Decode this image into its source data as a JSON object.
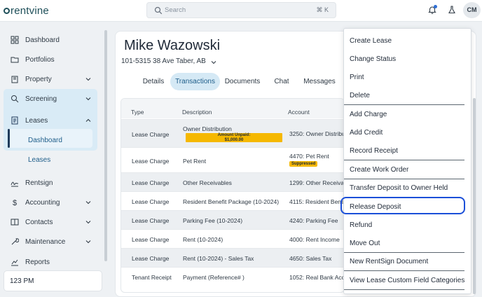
{
  "app": {
    "logo_text": "rentvine"
  },
  "search": {
    "placeholder": "Search",
    "shortcut": "⌘ K"
  },
  "user": {
    "initials": "CM"
  },
  "icons": {
    "logo": "rentvine-logo",
    "search": "search-icon",
    "bell": "bell-icon",
    "flask": "flask-icon",
    "dashboard": "grid-icon",
    "portfolios": "folder-icon",
    "property": "building-icon",
    "screening": "search-icon",
    "leases": "document-icon",
    "rentsign": "signature-icon",
    "accounting": "dollar-icon",
    "contacts": "address-book-icon",
    "maintenance": "wrench-icon",
    "reports": "chart-icon"
  },
  "sidebar": {
    "items": [
      {
        "label": "Dashboard"
      },
      {
        "label": "Portfolios"
      },
      {
        "label": "Property"
      },
      {
        "label": "Screening"
      },
      {
        "label": "Leases"
      },
      {
        "label": "Rentsign"
      },
      {
        "label": "Accounting"
      },
      {
        "label": "Contacts"
      },
      {
        "label": "Maintenance"
      },
      {
        "label": "Reports"
      }
    ],
    "lease_sub": [
      {
        "label": "Dashboard"
      },
      {
        "label": "Leases"
      }
    ],
    "time_text": "123 PM"
  },
  "lease": {
    "tenant_name": "Mike Wazowski",
    "address": "101-5315 38 Ave Taber, AB"
  },
  "tabs": [
    {
      "label": "Details"
    },
    {
      "label": "Transactions"
    },
    {
      "label": "Documents"
    },
    {
      "label": "Chat"
    },
    {
      "label": "Messages"
    }
  ],
  "table": {
    "headers": [
      "Type",
      "Description",
      "Account"
    ],
    "rows": [
      {
        "type": "Lease Charge",
        "description": "Owner Distribution",
        "account": "3250: Owner Distribu",
        "badge": "Amount Unpaid:\n$1,000.00"
      },
      {
        "type": "Lease Charge",
        "description": "Pet Rent",
        "account": "4470: Pet Rent",
        "badge": "Suppressed"
      },
      {
        "type": "Lease Charge",
        "description": "Other Receivables",
        "account": "1299: Other Receivabl"
      },
      {
        "type": "Lease Charge",
        "description": "Resident Benefit Package (10-2024)",
        "account": "4115: Resident Benefi"
      },
      {
        "type": "Lease Charge",
        "description": "Parking Fee (10-2024)",
        "account": "4240: Parking Fee"
      },
      {
        "type": "Lease Charge",
        "description": "Rent (10-2024)",
        "account": "4000: Rent Income"
      },
      {
        "type": "Lease Charge",
        "description": "Rent (10-2024) - Sales Tax",
        "account": "4650: Sales Tax"
      },
      {
        "type": "Tenant Receipt",
        "description": "Payment (Reference# )",
        "account": "1052: Real Bank Accou"
      }
    ]
  },
  "menu": {
    "items": [
      {
        "label": "Create Lease"
      },
      {
        "label": "Change Status"
      },
      {
        "label": "Print"
      },
      {
        "label": "Delete"
      },
      {
        "label": "Add Charge"
      },
      {
        "label": "Add Credit"
      },
      {
        "label": "Record Receipt"
      },
      {
        "label": "Create Work Order"
      },
      {
        "label": "Transfer Deposit to Owner Held"
      },
      {
        "label": "Release Deposit"
      },
      {
        "label": "Refund"
      },
      {
        "label": "Move Out"
      },
      {
        "label": "New RentSign Document"
      },
      {
        "label": "View Lease Custom Field Categories"
      }
    ]
  },
  "colors": {
    "brand": "#1e4f59",
    "active_tab": "#d5e9f5",
    "leases_group": "#d9ebf6",
    "badge_yellow": "#f5b800",
    "highlight_outline": "#1b4fd8"
  }
}
